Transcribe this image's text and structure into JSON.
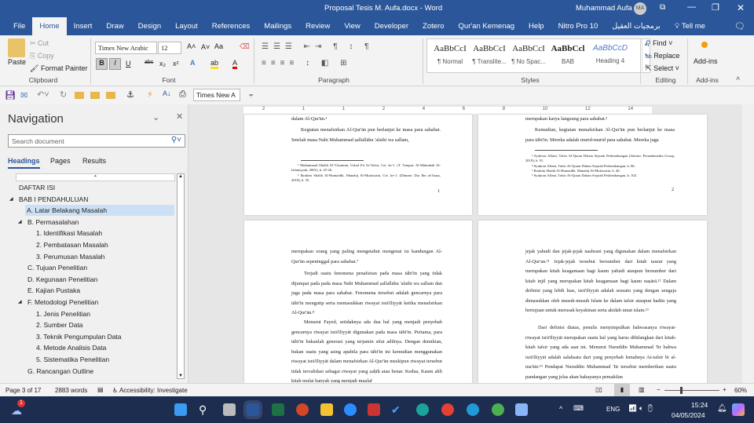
{
  "title_bar": {
    "document_title": "Proposal Tesis M. Aufa.docx  -  Word",
    "user_name": "Muhammad Aufa",
    "avatar_initials": "MA"
  },
  "ribbon_tabs": [
    "File",
    "Home",
    "Insert",
    "Draw",
    "Design",
    "Layout",
    "References",
    "Mailings",
    "Review",
    "View",
    "Developer",
    "Zotero",
    "Qur'an Kemenag",
    "Help",
    "Nitro Pro 10",
    "برمجيات العقيل",
    "Tell me"
  ],
  "clipboard": {
    "paste": "Paste",
    "cut": "Cut",
    "copy": "Copy",
    "format_painter": "Format Painter",
    "label": "Clipboard"
  },
  "font": {
    "name": "Times New Arabic",
    "size": "12",
    "bold": "B",
    "italic": "I",
    "underline": "U",
    "strike": "abc",
    "sub": "x₂",
    "sup": "x²",
    "case": "Aa",
    "label": "Font"
  },
  "paragraph": {
    "label": "Paragraph"
  },
  "styles": {
    "label": "Styles",
    "items": [
      {
        "preview": "AaBbCcI",
        "name": "¶ Normal"
      },
      {
        "preview": "AaBbCcI",
        "name": "¶ Translite..."
      },
      {
        "preview": "AaBbCcI",
        "name": "¶ No Spac..."
      },
      {
        "preview": "AaBbCcl",
        "name": "BAB"
      },
      {
        "preview": "AaBbCcD",
        "name": "Heading 4"
      }
    ]
  },
  "editing": {
    "find": "Find",
    "replace": "Replace",
    "select": "Select",
    "label": "Editing"
  },
  "addins": {
    "button": "Add-ins",
    "label": "Add-ins"
  },
  "qat": {
    "font_name": "Times New A"
  },
  "ruler": {
    "ticks": [
      "2",
      "1",
      "1",
      "2",
      "4",
      "6",
      "8",
      "10",
      "12",
      "14"
    ]
  },
  "navigation": {
    "title": "Navigation",
    "search_placeholder": "Search document",
    "tabs": [
      "Headings",
      "Pages",
      "Results"
    ],
    "headings": [
      {
        "text": "DAFTAR ISI",
        "level": 0
      },
      {
        "text": "BAB I PENDAHULUAN",
        "level": 0,
        "expanded": true
      },
      {
        "text": "A. Latar Belakang Masalah",
        "level": 1,
        "selected": true
      },
      {
        "text": "B. Permasalahan",
        "level": 1,
        "expanded": true
      },
      {
        "text": "1. Identifikasi Masalah",
        "level": 2
      },
      {
        "text": "2. Pembatasan Masalah",
        "level": 2
      },
      {
        "text": "3. Perumusan Masalah",
        "level": 2
      },
      {
        "text": "C. Tujuan Penelitian",
        "level": 1
      },
      {
        "text": "D. Kegunaan Penelitian",
        "level": 1
      },
      {
        "text": "E. Kajian Pustaka",
        "level": 1
      },
      {
        "text": "F. Metodologi Penelitian",
        "level": 1,
        "expanded": true
      },
      {
        "text": "1. Jenis Penelitian",
        "level": 2
      },
      {
        "text": "2. Sumber Data",
        "level": 2
      },
      {
        "text": "3. Teknik Pengumpulan Data",
        "level": 2
      },
      {
        "text": "4. Metode Analisis Data",
        "level": 2
      },
      {
        "text": "5. Sistematika Penelitian",
        "level": 2
      },
      {
        "text": "G. Rancangan Outline",
        "level": 1
      }
    ]
  },
  "pages": {
    "p1": {
      "line1": "dalam Al-Qur'ān.¹",
      "para": "Kegiatan menafsirkan Al-Qur'ān pun berlanjut ke masa para sahabat. Setelah masa Nabi Muhammad ṣallallāhu 'alaihi wa sallam,",
      "fn1": "¹ Muhammad Shalih Al-'Utsaimin, Ushul Fii At-Tafsir, Cet. ke-1. (T. Tempat: Al-Maktabah Al-Islamiyyah, 2001), h. 25-26.",
      "fn2": "² Ibrahim Shalih Al-Humaidhi, Manahij Al-Mufassirin, Cet. ke-1. (Dimam: Dar Ibn al-Jauzy, 2018), h. 35.",
      "num": "1"
    },
    "p2": {
      "line1": "merupakan karya langsung para sahabat.³",
      "para": "Kemudian, kegiatan menafsirkan Al-Qur'ān pun berlanjut ke masa para tābi'īn. Mereka adalah murid-murid para sahabat. Mereka juga",
      "fn1": "³ Syukron Affani, Tafsir Al-Quran Dalam Sejarah Perkembangan (Jakarta: Prenadamedia Group, 2019), h. 91.",
      "fn2": "⁴ Syukron Affani, Tafsir Al-Quran Dalam Sejarah Perkembangan, h. 86.",
      "fn3": "⁵ Ibrahim Shalih Al-Humaidhi, Manahij Al-Mufassirin, h. 40.",
      "fn4": "⁶ Syukron Affani, Tafsir Al-Quran Dalam Sejarah Perkembangan, h. 102.",
      "num": "2"
    },
    "p3": {
      "line1": "merupakan orang yang paling mengetahui mengenai isi kandungan Al-Qur'ān sepeninggal para sahabat.⁷",
      "para1": "Terjadi suatu fenomena penafsiran pada masa tābi'īn yang tidak dijumpai pada pada masa Nabi Muhammad ṣallallāhu 'alaihi wa sallam dan juga pada masa para sahabat. Fenomena tersebut adalah gencarnya para tābi'īn mengutip serta memasukkan riwayat isrā'īliyyāt ketika menafsirkan Al-Qur'ān.⁸",
      "para2": "Menurut Fayed, setidaknya ada dua hal yang menjadi penyebab gencarnya riwayat isrā'īliyyāt digunakan pada masa tābi'īn. Pertama, para tābi'īn bukanlah generasi yang terjamin sifat adilnya. Dengan demikian, bukan suatu yang asing apabila para tābi'īn ini kemudian menggunakan riwayat isrā'īliyyāt dalam menafsirkan Al-Qur'ān meskipun riwayat tersebut tidak tervalidasi sebagai riwayat yang ṣaḥīḥ atau benar. Kedua, Kaum ahli kitab mulai banyak yang menjadi mualaf"
    },
    "p4": {
      "para1": "jejak yahudi dan jejak-jejak nashrani yang digunakan dalam menafsirkan Al-Qur'an.¹¹ Jejak-jejak tersebut bersumber dari kitab taurat yang merupakan kitab keagamaan bagi kaum yahudi ataupun bersumber dari kitab injil yang merupakan kitab keagamaan bagi kaum naṣārā.¹² Dalam definisi yang lebih luas, isrā'īliyyāt adalah sesuatu yang dengan sengaja dimasukkan oleh musuh-musuh Islam ke dalam tafsir ataupun hadits yang bertujuan untuk merusak keyakinan serta akidah umat islam.¹³",
      "para2": "Dari definisi diatas, penulis menyimpulkan bahwasanya riwayat-riwayat isrā'īliyyāt merupakan suatu hal yang harus dihilangkan dari kitab-kitab tafsir yang ada saat ini. Menurut Nuruddin Muhammad 'Itr bahwa isrā'īliyyāt adalah salahsatu dari yang penyebab lemahnya At-tafsīr bi al-ma'ṡūr.¹⁴ Pendapat Nuruddin Muhammad 'Itr tersebut memberikan suatu pandangan yang jelas akan bahayanya pemakilan"
    }
  },
  "status": {
    "page": "Page 3 of 17",
    "words": "2883 words",
    "accessibility": "Accessibility: Investigate",
    "zoom": "60%",
    "minus": "−",
    "plus": "+"
  },
  "taskbar": {
    "time": "15:24",
    "date": "04/05/2024",
    "lang": "ENG",
    "notification_badge": "1"
  },
  "colors": {
    "brand": "#2b579a",
    "taskbar": "#1d2d4f",
    "selected_heading": "#cce0f5"
  }
}
